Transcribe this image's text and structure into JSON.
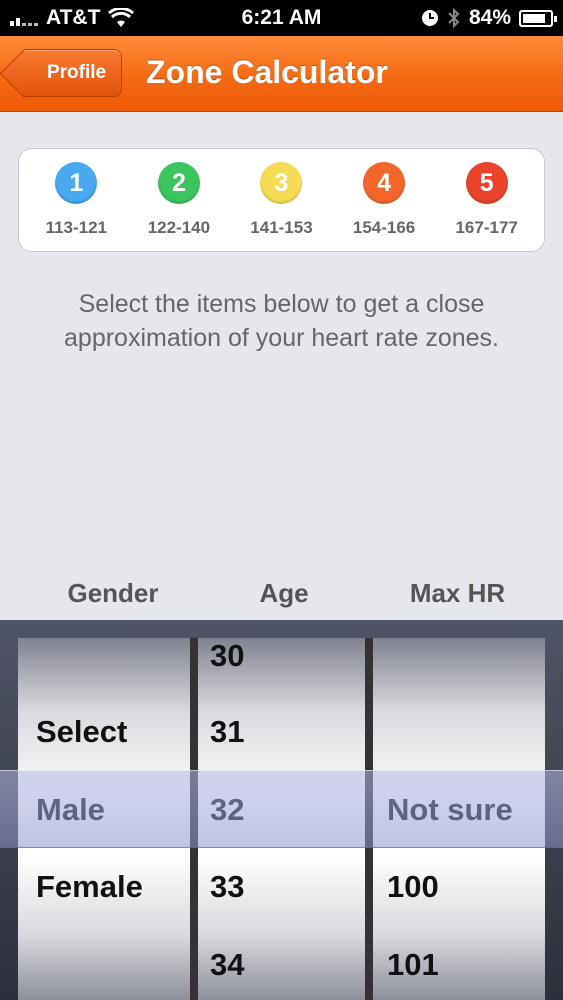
{
  "status_bar": {
    "carrier": "AT&T",
    "time": "6:21 AM",
    "battery": "84%",
    "icons": [
      "signal-icon",
      "wifi-icon",
      "alarm-icon",
      "bluetooth-icon",
      "battery-icon"
    ]
  },
  "nav": {
    "back_label": "Profile",
    "title": "Zone Calculator",
    "accent": "#f36a14"
  },
  "zones": [
    {
      "number": "1",
      "range": "113-121",
      "color": "#4aa8f0"
    },
    {
      "number": "2",
      "range": "122-140",
      "color": "#3bc460"
    },
    {
      "number": "3",
      "range": "141-153",
      "color": "#f6dc54"
    },
    {
      "number": "4",
      "range": "154-166",
      "color": "#f4652a"
    },
    {
      "number": "5",
      "range": "167-177",
      "color": "#e9432c"
    }
  ],
  "instructions": "Select the items below to get a close approximation of your heart rate zones.",
  "picker": {
    "labels": {
      "gender": "Gender",
      "age": "Age",
      "max_hr": "Max HR"
    },
    "gender": [
      "Select",
      "Male",
      "Female"
    ],
    "age": [
      "30",
      "31",
      "32",
      "33",
      "34"
    ],
    "max_hr": [
      "Not sure",
      "100",
      "101"
    ],
    "selected": {
      "gender": "Male",
      "age": "32",
      "max_hr": "Not sure"
    }
  }
}
